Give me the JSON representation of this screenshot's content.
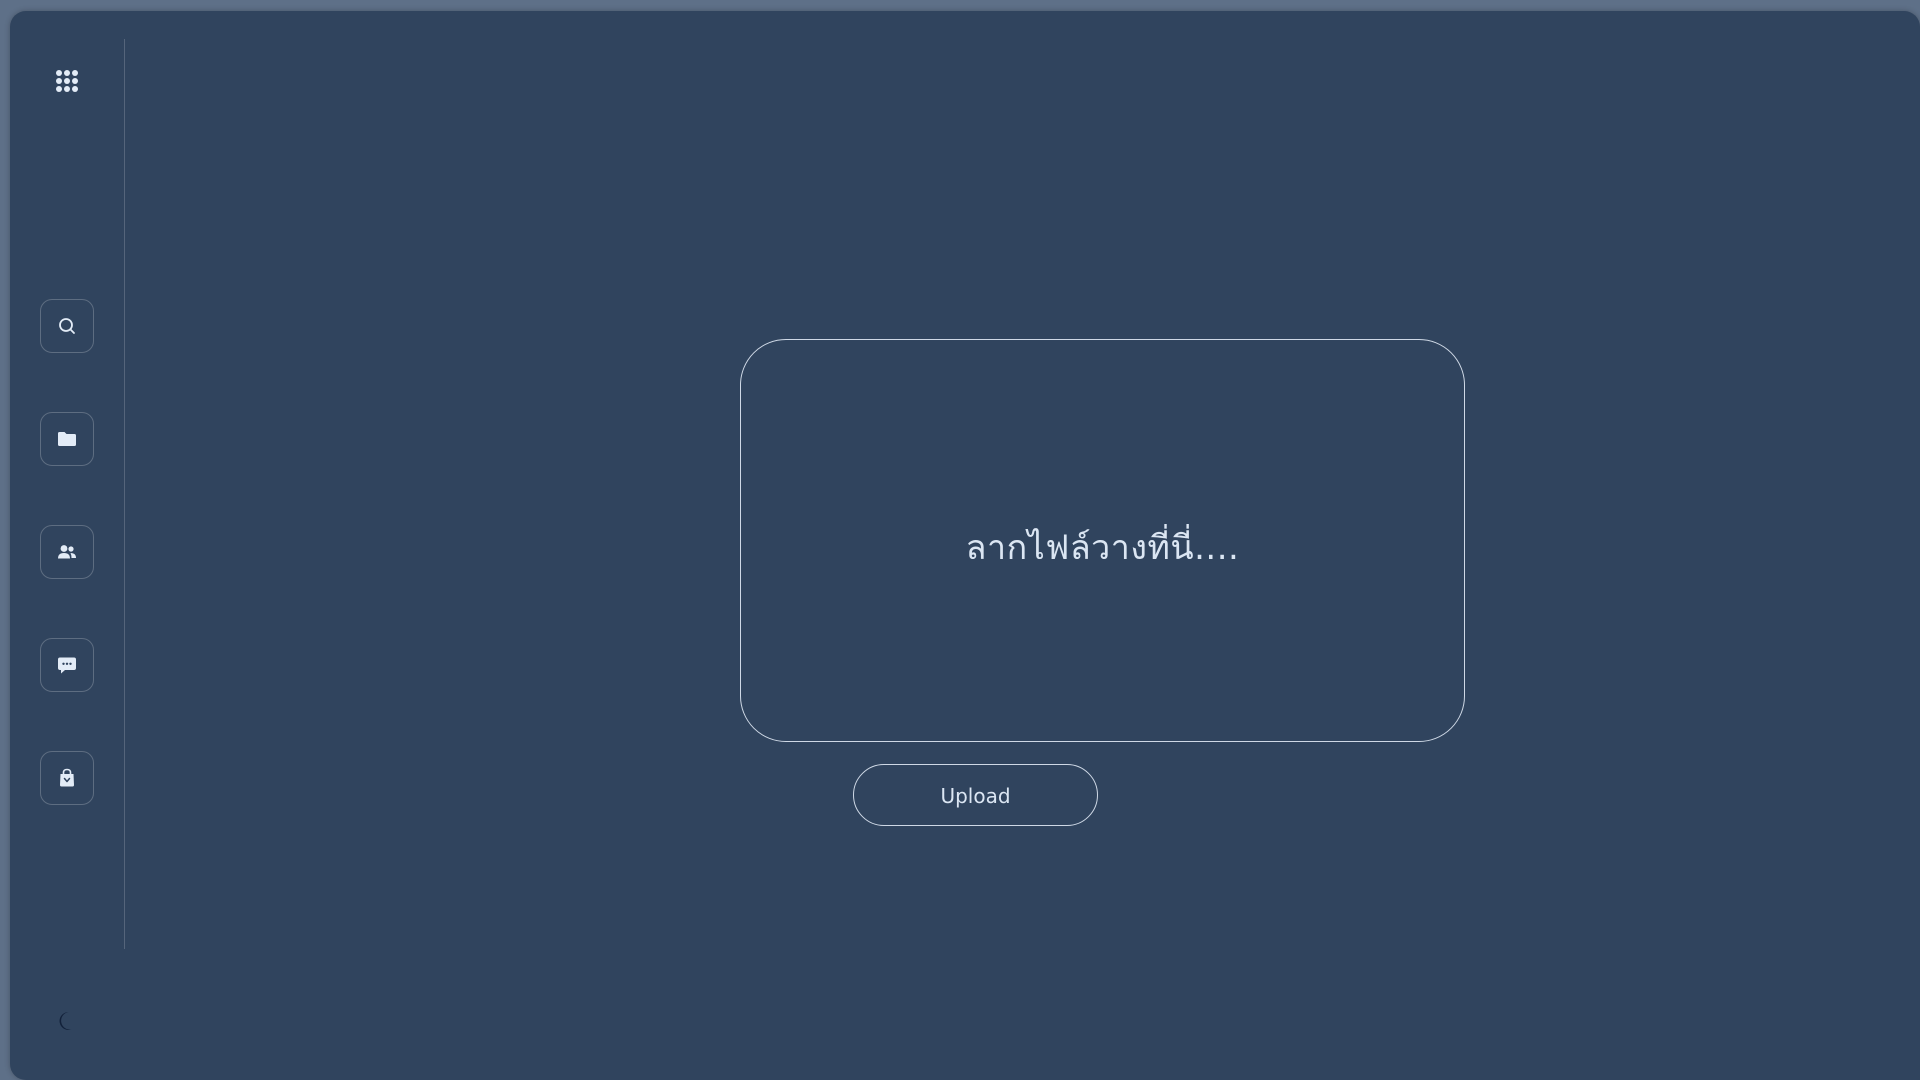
{
  "sidebar": {
    "top_icon": "apps-grid-icon",
    "items": [
      {
        "name": "search",
        "icon": "search-icon"
      },
      {
        "name": "files",
        "icon": "folder-icon"
      },
      {
        "name": "users",
        "icon": "users-icon"
      },
      {
        "name": "messages",
        "icon": "chat-icon"
      },
      {
        "name": "store",
        "icon": "shopping-bag-icon"
      }
    ],
    "bottom_icon": "moon-icon"
  },
  "dropzone": {
    "text": "ลากไฟล์วางที่นี่...."
  },
  "upload_button": {
    "label": "Upload"
  },
  "colors": {
    "background": "#30445e",
    "outline": "#cfd9e6",
    "text": "#dbe6f3",
    "icon": "#e3ecf7"
  }
}
